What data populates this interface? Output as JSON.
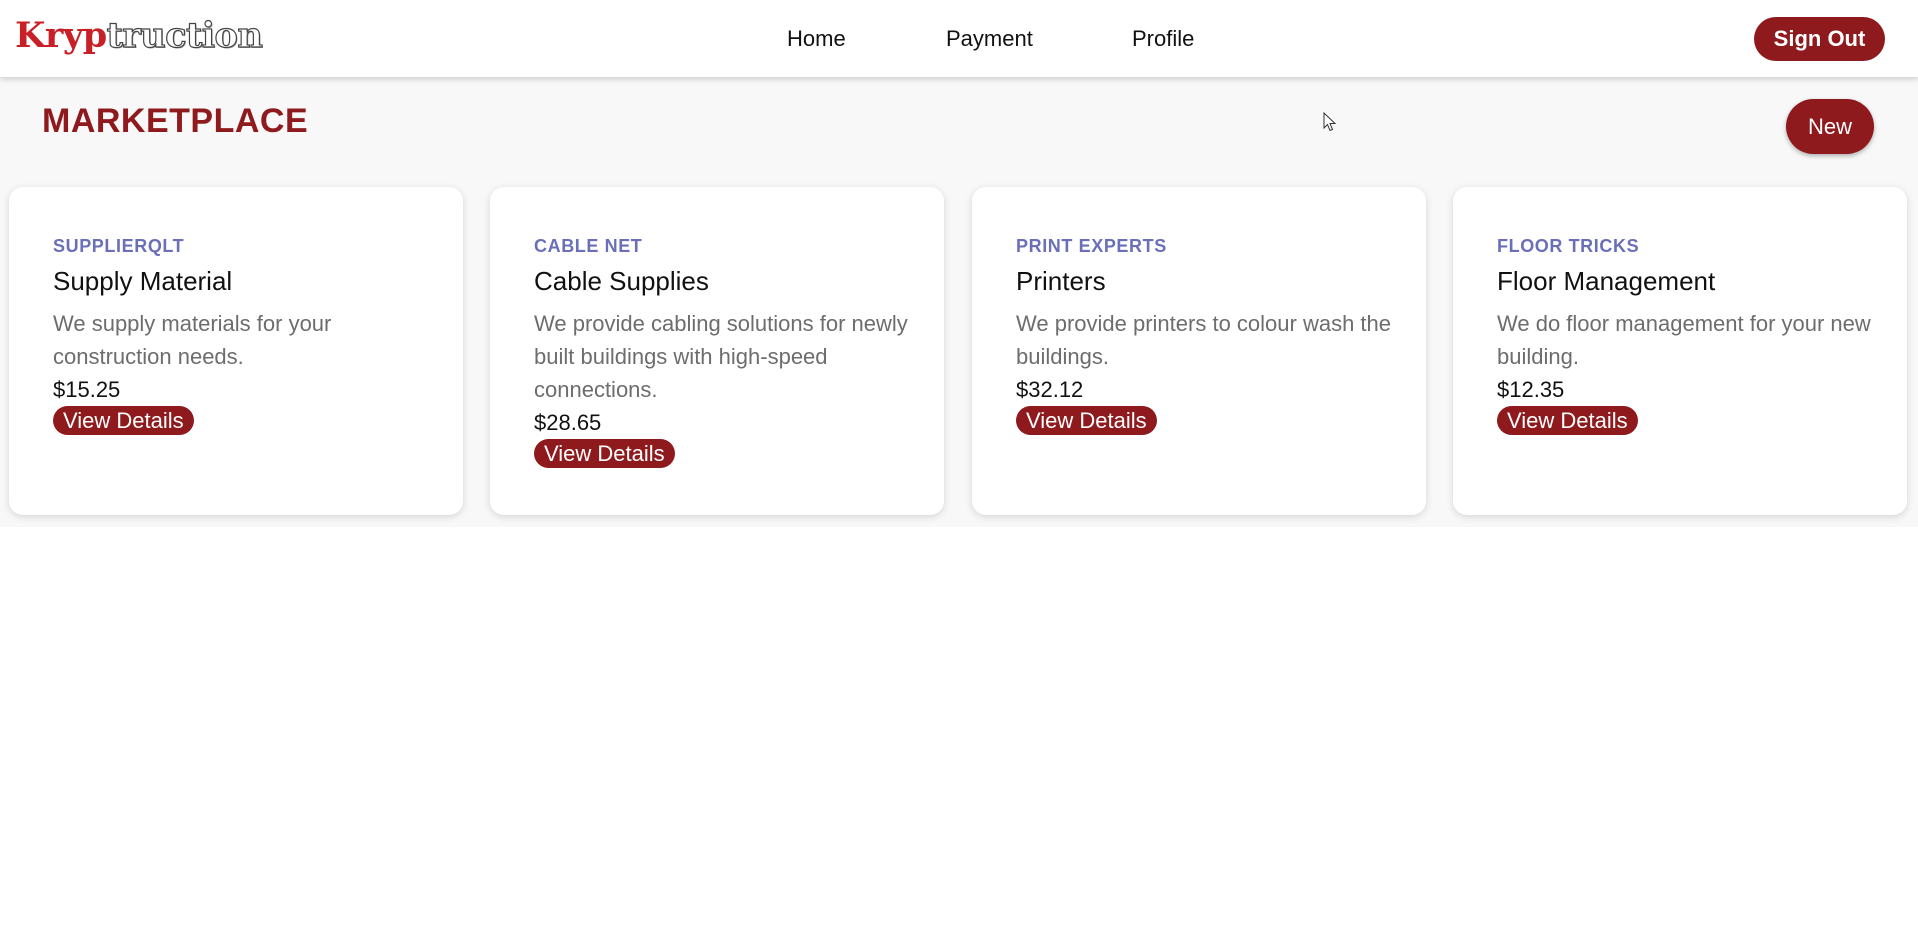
{
  "header": {
    "logo_part1": "Kryp",
    "logo_part2": "truction",
    "nav": [
      "Home",
      "Payment",
      "Profile"
    ],
    "sign_out_label": "Sign Out"
  },
  "page": {
    "title": "MARKETPLACE",
    "new_label": "New"
  },
  "colors": {
    "brand": "#8f1a1d",
    "supplier_text": "#6a6fb8",
    "description_text": "#6d6d6d",
    "section_bg": "#f8f8f8"
  },
  "cards": [
    {
      "supplier": "SUPPLIERQLT",
      "title": "Supply Material",
      "description": "We supply materials for your construction needs.",
      "price": "$15.25",
      "button_label": "View Details"
    },
    {
      "supplier": "CABLE NET",
      "title": "Cable Supplies",
      "description": "We provide cabling solutions for newly built buildings with high-speed connections.",
      "price": "$28.65",
      "button_label": "View Details"
    },
    {
      "supplier": "PRINT EXPERTS",
      "title": "Printers",
      "description": "We provide printers to colour wash the buildings.",
      "price": "$32.12",
      "button_label": "View Details"
    },
    {
      "supplier": "FLOOR TRICKS",
      "title": "Floor Management",
      "description": "We do floor management for your new building.",
      "price": "$12.35",
      "button_label": "View Details"
    }
  ]
}
